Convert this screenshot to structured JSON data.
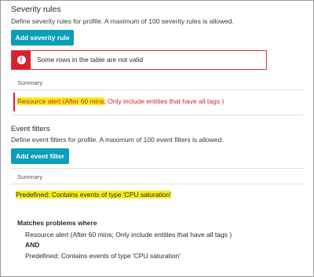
{
  "severity": {
    "title": "Severity rules",
    "description": "Define severity rules for profile. A maximum of 100 severity rules is allowed.",
    "add_button": "Add severity rule",
    "alert_text": "Some rows in the table are not valid",
    "summary_header": "Summary",
    "row_highlight": "Resource alert (After 60 mins",
    "row_rest": "; Only include entities that have all tags )"
  },
  "events": {
    "title": "Event filters",
    "description": "Define event filters for profile. A maximum of 100 event filters is allowed.",
    "add_button": "Add event filter",
    "summary_header": "Summary",
    "row_text": "Predefined: Contains events of type 'CPU saturation'"
  },
  "matches": {
    "title": "Matches problems where",
    "line1": "Resource alert (After 60 mins; Only include entities that have all tags )",
    "and_label": "AND",
    "line2": "Predefined: Contains events of type 'CPU saturation'"
  },
  "colors": {
    "accent": "#0a9fb7",
    "error": "#d7212b",
    "highlight": "#f4ef1c"
  }
}
